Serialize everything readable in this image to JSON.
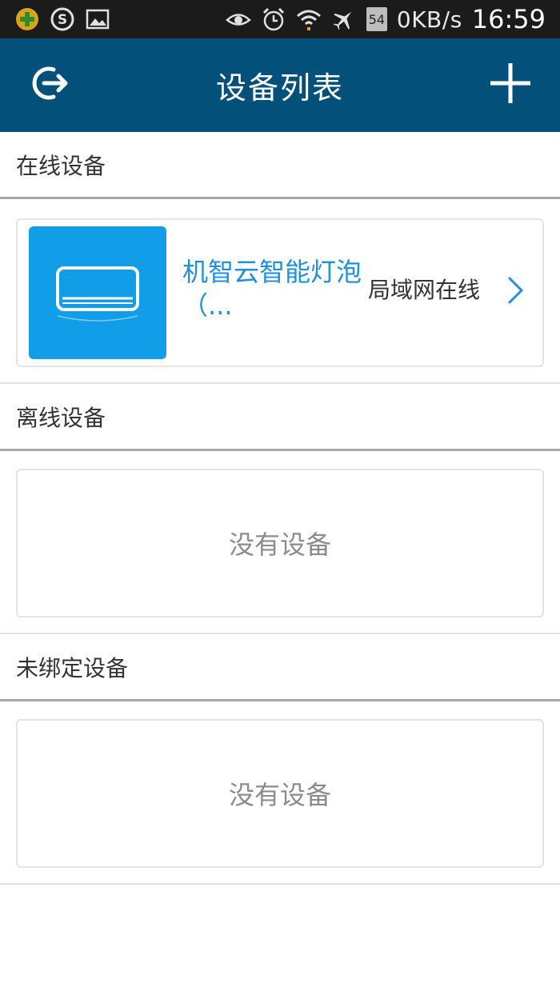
{
  "status_bar": {
    "notification_badge": "54",
    "net_speed": "0KB/s",
    "time": "16:59",
    "icons": [
      "puzzle-icon",
      "s-circle-icon",
      "image-icon",
      "eye-icon",
      "alarm-icon",
      "wifi-icon",
      "airplane-icon"
    ]
  },
  "appbar": {
    "title": "设备列表",
    "left_icon": "logout-icon",
    "right_icon": "plus-icon"
  },
  "sections": {
    "online": {
      "title": "在线设备",
      "devices": [
        {
          "name": "机智云智能灯泡（...",
          "status": "局域网在线",
          "icon": "air-conditioner-icon"
        }
      ]
    },
    "offline": {
      "title": "离线设备",
      "empty_text": "没有设备"
    },
    "unbound": {
      "title": "未绑定设备",
      "empty_text": "没有设备"
    }
  },
  "colors": {
    "appbar": "#03507b",
    "accent": "#1f8fe0",
    "thumb": "#129de8"
  }
}
